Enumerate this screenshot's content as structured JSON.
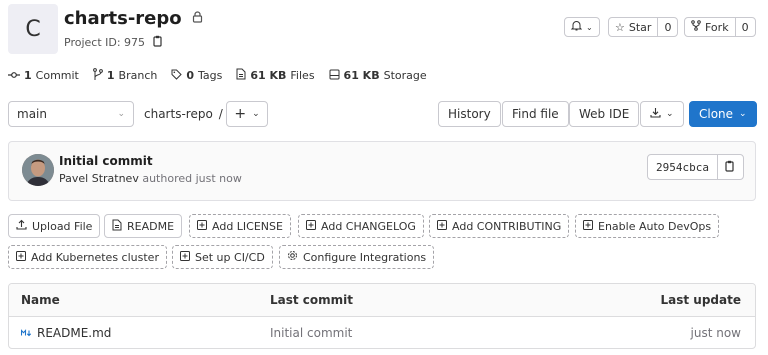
{
  "project": {
    "avatar_letter": "C",
    "name": "charts-repo",
    "id_label": "Project ID: 975"
  },
  "header_actions": {
    "notify_icon": "bell-icon",
    "star_label": "Star",
    "star_count": "0",
    "fork_label": "Fork",
    "fork_count": "0"
  },
  "stats": [
    {
      "icon": "commit-icon",
      "value": "1",
      "label": "Commit"
    },
    {
      "icon": "branch-icon",
      "value": "1",
      "label": "Branch"
    },
    {
      "icon": "tag-icon",
      "value": "0",
      "label": "Tags"
    },
    {
      "icon": "file-icon",
      "value": "61 KB",
      "label": "Files"
    },
    {
      "icon": "storage-icon",
      "value": "61 KB",
      "label": "Storage"
    }
  ],
  "branch_bar": {
    "branch": "main",
    "path_root": "charts-repo",
    "separator": "/",
    "history": "History",
    "find_file": "Find file",
    "web_ide": "Web IDE",
    "clone": "Clone"
  },
  "last_commit": {
    "title": "Initial commit",
    "author": "Pavel Stratnev",
    "meta": "authored just now",
    "sha": "2954cbca"
  },
  "quick_actions": [
    "Upload File",
    "README",
    "Add LICENSE",
    "Add CHANGELOG",
    "Add CONTRIBUTING",
    "Enable Auto DevOps",
    "Add Kubernetes cluster",
    "Set up CI/CD",
    "Configure Integrations"
  ],
  "table": {
    "headers": {
      "name": "Name",
      "last_commit": "Last commit",
      "last_update": "Last update"
    },
    "rows": [
      {
        "name": "README.md",
        "last_commit": "Initial commit",
        "last_update": "just now"
      }
    ]
  },
  "colors": {
    "primary": "#1f75cb",
    "markdown_icon": "#1f75cb"
  }
}
